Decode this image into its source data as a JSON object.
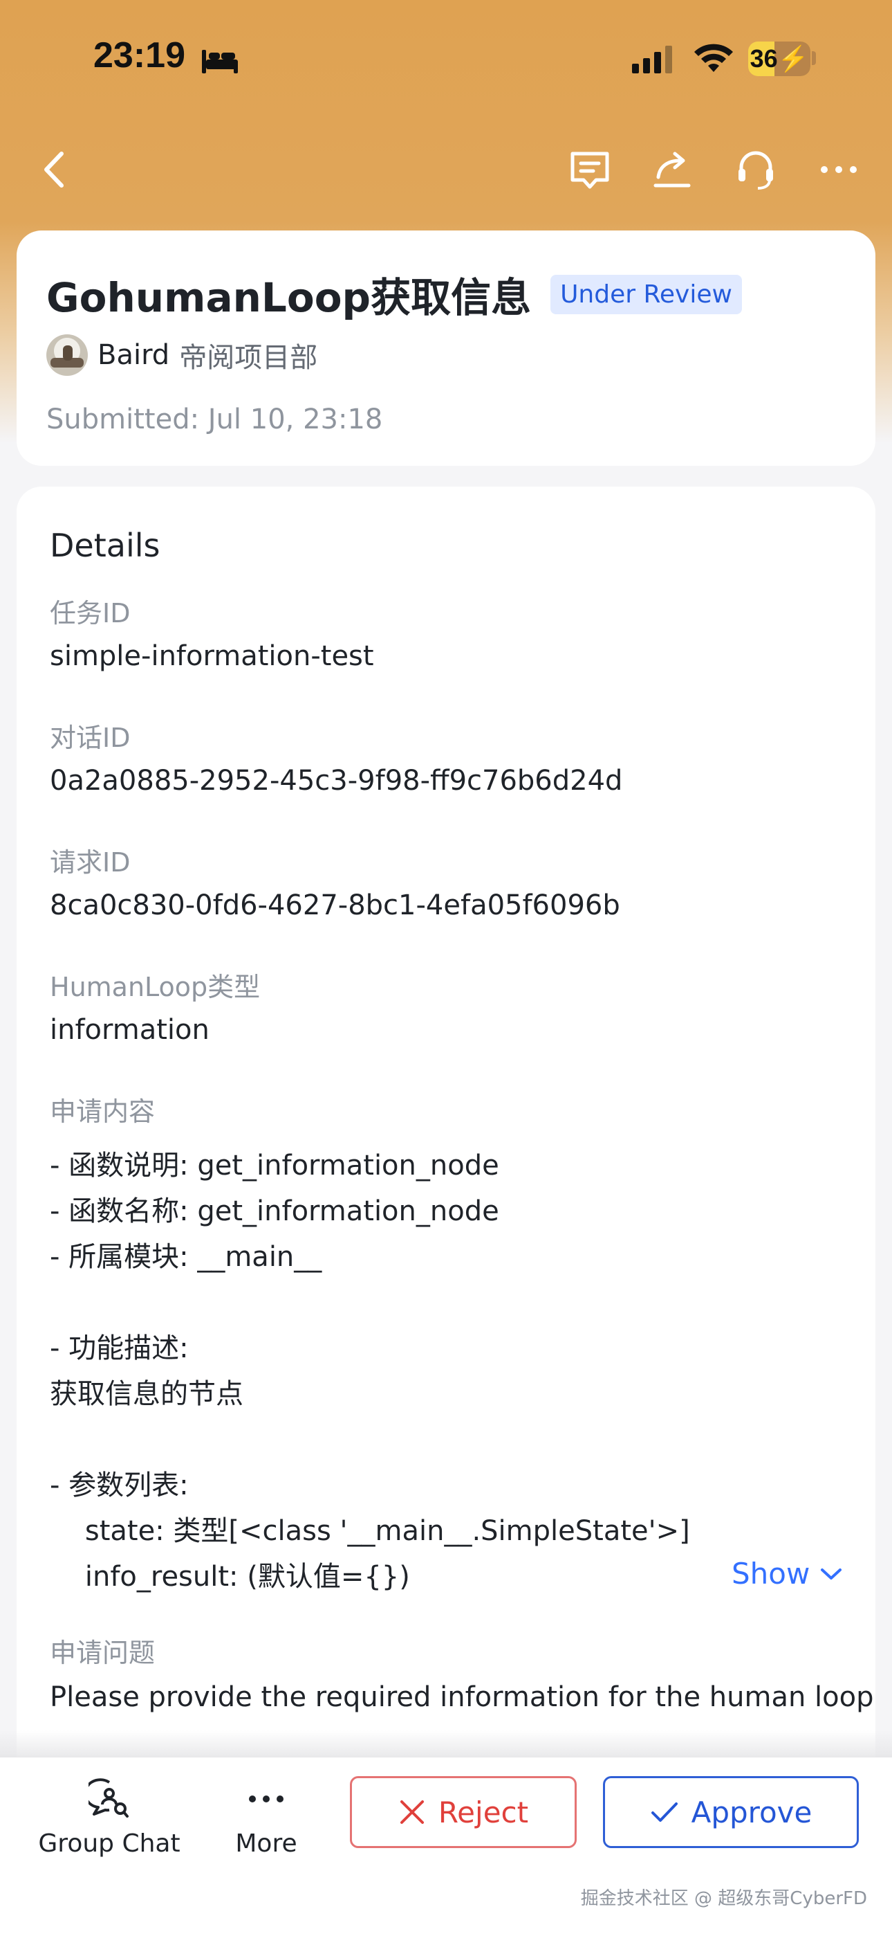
{
  "status_bar": {
    "time": "23:19",
    "battery": "36",
    "icons": [
      "bed-icon",
      "cellular-signal-icon",
      "wifi-icon",
      "battery-charging-icon"
    ]
  },
  "nav": {
    "icons": [
      "back-arrow-icon",
      "comment-icon",
      "share-icon",
      "support-headset-icon",
      "more-dots-icon"
    ]
  },
  "header": {
    "title": "GohumanLoop获取信息",
    "status": "Under Review",
    "submitter_name": "Baird",
    "submitter_dept": "帝阅项目部",
    "submitted": "Submitted: Jul 10, 23:18"
  },
  "details": {
    "title": "Details",
    "fields": [
      {
        "label": "任务ID",
        "value": "simple-information-test"
      },
      {
        "label": "对话ID",
        "value": "0a2a0885-2952-45c3-9f98-ff9c76b6d24d"
      },
      {
        "label": "请求ID",
        "value": "8ca0c830-0fd6-4627-8bc1-4efa05f6096b"
      },
      {
        "label": "HumanLoop类型",
        "value": "information"
      }
    ],
    "content_label": "申请内容",
    "content_lines": [
      "- 函数说明: get_information_node",
      "- 函数名称: get_information_node",
      "- 所属模块: __main__",
      "- 功能描述:",
      "获取信息的节点",
      "- 参数列表:",
      "    state: 类型[<class '__main__.SimpleState'>]",
      "    info_result: (默认值={})"
    ],
    "show_label": "Show",
    "question_label": "申请问题",
    "question_value": "Please provide the required information for the human loop"
  },
  "bottom_bar": {
    "group_chat": "Group Chat",
    "more": "More",
    "reject": "Reject",
    "approve": "Approve"
  },
  "colors": {
    "header_orange": "#dfa252",
    "badge_bg": "#e1eaff",
    "badge_text": "#245bdb",
    "reject_red": "#e0403b",
    "approve_blue": "#2456d6",
    "link_blue": "#3370ff"
  },
  "watermark": "掘金技术社区 @ 超级东哥CyberFD"
}
